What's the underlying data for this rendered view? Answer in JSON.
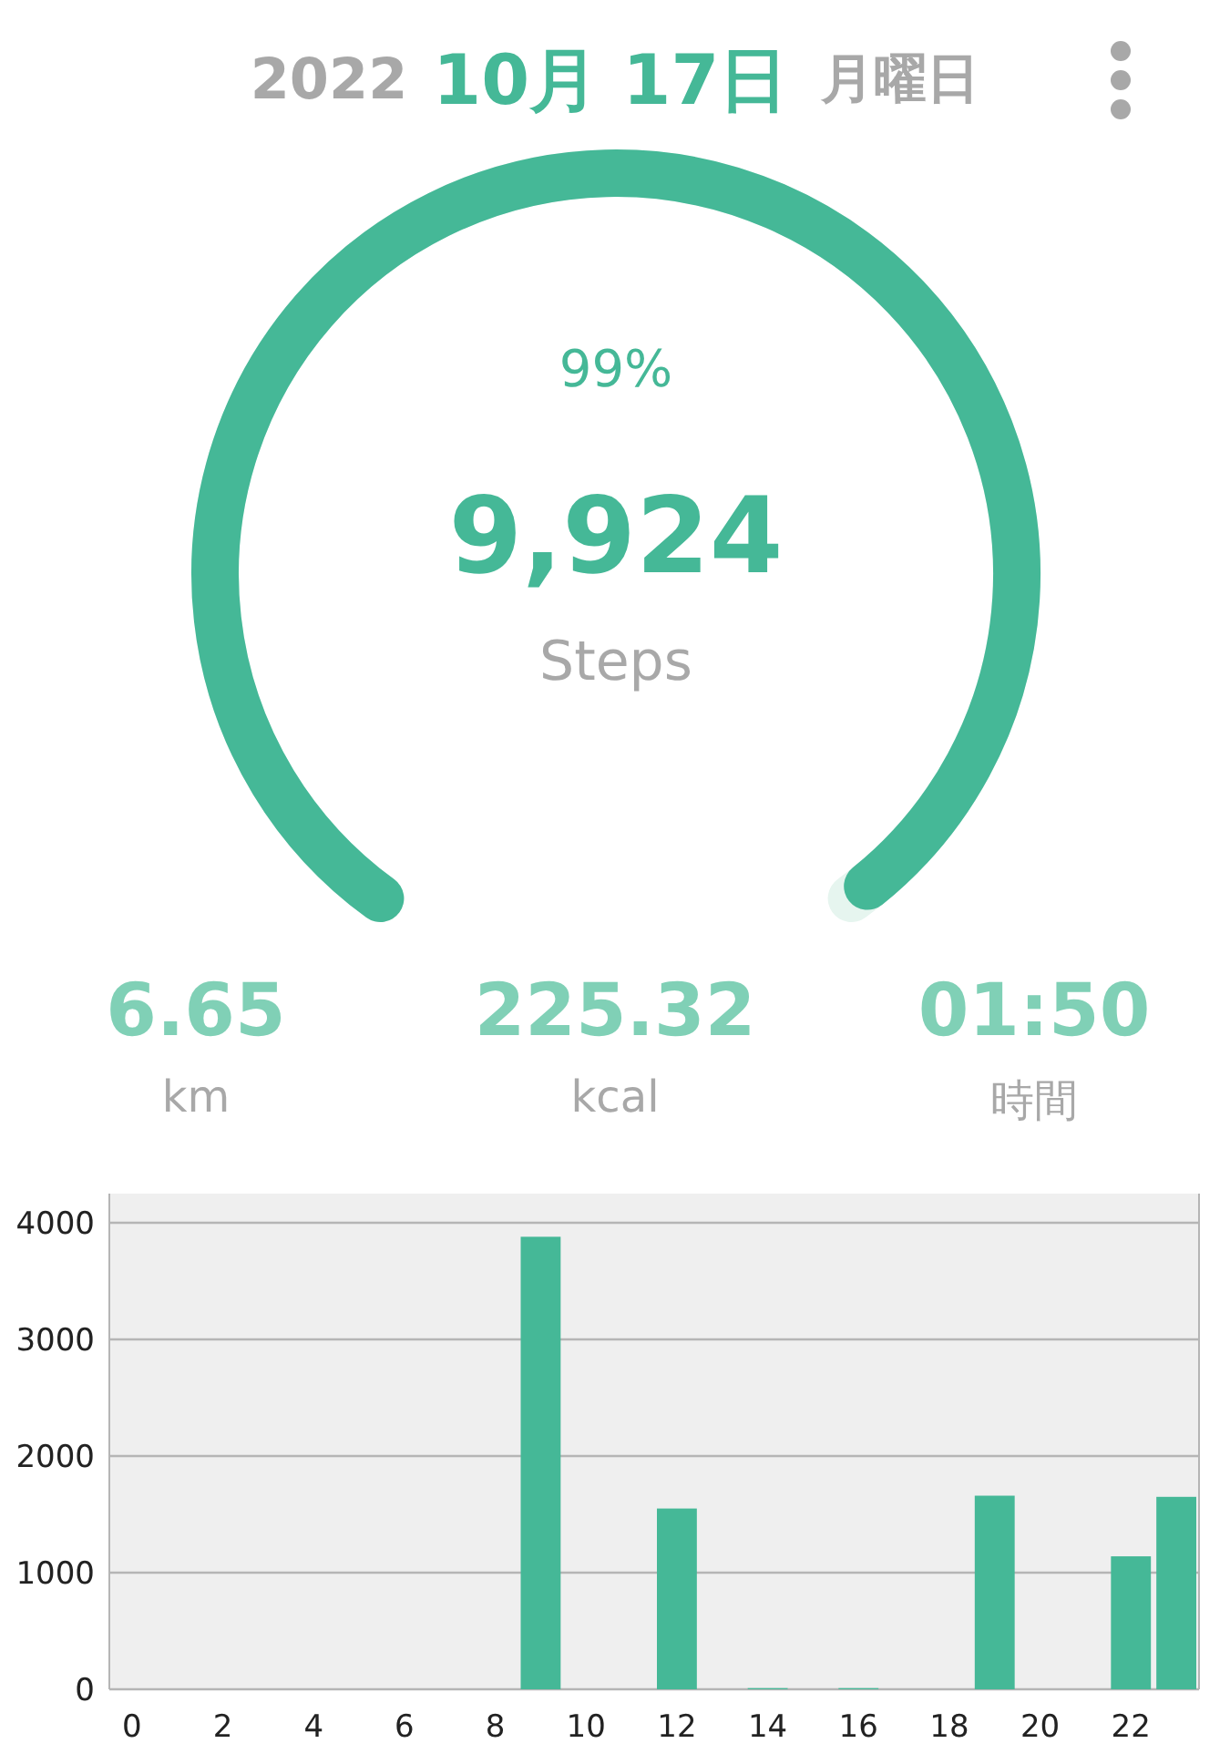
{
  "header": {
    "year": "2022",
    "date": "10月 17日",
    "weekday": "月曜日"
  },
  "gauge": {
    "level": 0.99,
    "percent": "99%",
    "steps": "9,924",
    "unit": "Steps"
  },
  "stats": [
    {
      "value": "6.65",
      "label": "km"
    },
    {
      "value": "225.32",
      "label": "kcal"
    },
    {
      "value": "01:50",
      "label": "時間"
    }
  ],
  "chart_data": {
    "type": "bar",
    "x": [
      0,
      1,
      2,
      3,
      4,
      5,
      6,
      7,
      8,
      9,
      10,
      11,
      12,
      13,
      14,
      15,
      16,
      17,
      18,
      19,
      20,
      21,
      22,
      23
    ],
    "values": [
      0,
      0,
      0,
      0,
      0,
      0,
      0,
      0,
      0,
      3880,
      0,
      0,
      1550,
      0,
      10,
      0,
      10,
      0,
      0,
      1660,
      0,
      0,
      1140,
      1650
    ],
    "xlim": [
      -0.5,
      23.5
    ],
    "ylim": [
      0,
      4250
    ],
    "grid": true,
    "yticks": [
      0,
      1000,
      2000,
      3000,
      4000
    ],
    "xticks": [
      0,
      2,
      4,
      6,
      8,
      10,
      12,
      14,
      16,
      18,
      20,
      22
    ]
  }
}
